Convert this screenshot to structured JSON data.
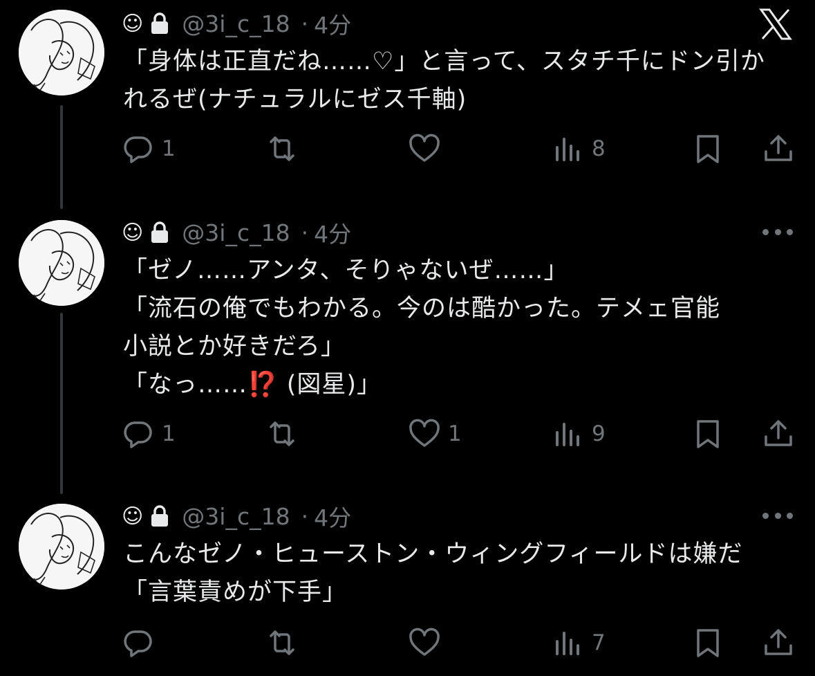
{
  "tweets": [
    {
      "avatar_icon": "avatar-sketch",
      "header": {
        "smile": "☺",
        "lock_icon": "lock-icon",
        "handle": "@3i_c_18",
        "dot": "·",
        "time": "4分"
      },
      "corner_icon": "x-logo-icon",
      "text": "「身体は正直だね……♡」と言って、スタチ千にドン引か\nれるぜ(ナチュラルにゼス千軸)",
      "actions": {
        "reply": "1",
        "retweet": "",
        "like": "",
        "views": "8"
      }
    },
    {
      "avatar_icon": "avatar-sketch",
      "header": {
        "smile": "☺",
        "lock_icon": "lock-icon",
        "handle": "@3i_c_18",
        "dot": "·",
        "time": "4分"
      },
      "corner_icon": "more-icon",
      "text": "「ゼノ……アンタ、そりゃないぜ……」\n「流石の俺でもわかる。今のは酷かった。テメェ官能\n小説とか好きだろ」\n「なっ……",
      "emoji": "⁉️",
      "text_after": " (図星)」",
      "actions": {
        "reply": "1",
        "retweet": "",
        "like": "1",
        "views": "9"
      }
    },
    {
      "avatar_icon": "avatar-sketch",
      "header": {
        "smile": "☺",
        "lock_icon": "lock-icon",
        "handle": "@3i_c_18",
        "dot": "·",
        "time": "4分"
      },
      "corner_icon": "more-icon",
      "text": "こんなゼノ・ヒューストン・ウィングフィールドは嫌だ\n「言葉責めが下手」",
      "actions": {
        "reply": "",
        "retweet": "",
        "like": "",
        "views": "7"
      }
    }
  ],
  "colors": {
    "background": "#000000",
    "text": "#e7e9ea",
    "muted": "#71767b",
    "thread_line": "#333639",
    "emoji": "#e0402d"
  }
}
